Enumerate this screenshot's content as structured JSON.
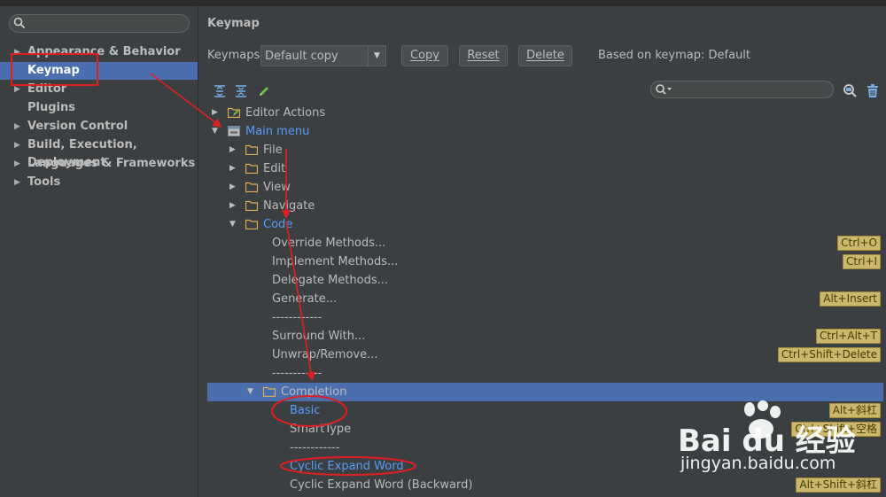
{
  "sidebar": {
    "search_placeholder": "",
    "items": [
      {
        "label": "Appearance & Behavior",
        "expandable": true
      },
      {
        "label": "Keymap",
        "expandable": false,
        "selected": true
      },
      {
        "label": "Editor",
        "expandable": true
      },
      {
        "label": "Plugins",
        "expandable": false
      },
      {
        "label": "Version Control",
        "expandable": true
      },
      {
        "label": "Build, Execution, Deployment",
        "expandable": true
      },
      {
        "label": "Languages & Frameworks",
        "expandable": true
      },
      {
        "label": "Tools",
        "expandable": true
      }
    ]
  },
  "main": {
    "title": "Keymap",
    "keymaps_label": "Keymaps:",
    "keymap_value": "Default copy",
    "copy_label": "Copy",
    "reset_label": "Reset",
    "delete_label": "Delete",
    "based_on": "Based on keymap: Default",
    "filter_placeholder": ""
  },
  "tree": [
    {
      "label": "Editor Actions",
      "arrow": "▶",
      "icon": "editor-actions-icon",
      "blue": false,
      "shortcut": ""
    },
    {
      "label": "Main menu",
      "arrow": "▼",
      "icon": "menu-icon",
      "blue": true,
      "shortcut": ""
    },
    {
      "label": "File",
      "arrow": "▶",
      "icon": "folder-icon",
      "blue": false,
      "shortcut": ""
    },
    {
      "label": "Edit",
      "arrow": "▶",
      "icon": "folder-icon",
      "blue": false,
      "shortcut": ""
    },
    {
      "label": "View",
      "arrow": "▶",
      "icon": "folder-icon",
      "blue": false,
      "shortcut": ""
    },
    {
      "label": "Navigate",
      "arrow": "▶",
      "icon": "folder-icon",
      "blue": false,
      "shortcut": ""
    },
    {
      "label": "Code",
      "arrow": "▼",
      "icon": "folder-icon",
      "blue": true,
      "shortcut": ""
    },
    {
      "label": "Override Methods...",
      "arrow": "",
      "icon": "",
      "blue": false,
      "shortcut": "Ctrl+O"
    },
    {
      "label": "Implement Methods...",
      "arrow": "",
      "icon": "",
      "blue": false,
      "shortcut": "Ctrl+I"
    },
    {
      "label": "Delegate Methods...",
      "arrow": "",
      "icon": "",
      "blue": false,
      "shortcut": ""
    },
    {
      "label": "Generate...",
      "arrow": "",
      "icon": "",
      "blue": false,
      "shortcut": "Alt+Insert"
    },
    {
      "label": "------------",
      "arrow": "",
      "icon": "",
      "blue": false,
      "shortcut": ""
    },
    {
      "label": "Surround With...",
      "arrow": "",
      "icon": "",
      "blue": false,
      "shortcut": "Ctrl+Alt+T"
    },
    {
      "label": "Unwrap/Remove...",
      "arrow": "",
      "icon": "",
      "blue": false,
      "shortcut": "Ctrl+Shift+Delete"
    },
    {
      "label": "------------",
      "arrow": "",
      "icon": "",
      "blue": false,
      "shortcut": ""
    },
    {
      "label": "Completion",
      "arrow": "▼",
      "icon": "folder-icon",
      "blue": false,
      "shortcut": "",
      "selected": true
    },
    {
      "label": "Basic",
      "arrow": "",
      "icon": "",
      "blue": true,
      "shortcut": "Alt+斜杠"
    },
    {
      "label": "SmartType",
      "arrow": "",
      "icon": "",
      "blue": false,
      "shortcut": "Ctrl+Shift+空格"
    },
    {
      "label": "------------",
      "arrow": "",
      "icon": "",
      "blue": false,
      "shortcut": ""
    },
    {
      "label": "Cyclic Expand Word",
      "arrow": "",
      "icon": "",
      "blue": true,
      "shortcut": ""
    },
    {
      "label": "Cyclic Expand Word (Backward)",
      "arrow": "",
      "icon": "",
      "blue": false,
      "shortcut": "Alt+Shift+斜杠"
    }
  ],
  "watermark": {
    "brand": "Bai du 经验",
    "url": "jingyan.baidu.com"
  },
  "colors": {
    "selection": "#4b6eaf",
    "link_blue": "#589df6",
    "shortcut_bg": "#cbb86d",
    "annotation_red": "#e02020"
  }
}
